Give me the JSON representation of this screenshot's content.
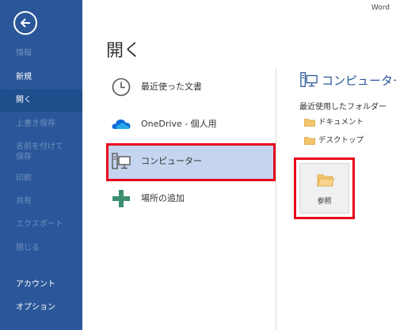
{
  "app": {
    "name": "Word"
  },
  "sidebar": {
    "items": [
      {
        "label": "情報"
      },
      {
        "label": "新規"
      },
      {
        "label": "開く"
      },
      {
        "label": "上書き保存"
      },
      {
        "label_line1": "名前を付けて",
        "label_line2": "保存"
      },
      {
        "label": "印刷"
      },
      {
        "label": "共有"
      },
      {
        "label": "エクスポート"
      },
      {
        "label": "閉じる"
      },
      {
        "label": "アカウント"
      },
      {
        "label": "オプション"
      }
    ]
  },
  "main": {
    "title": "開く",
    "places": [
      {
        "label": "最近使った文書",
        "icon": "clock-icon"
      },
      {
        "label": "OneDrive - 個人用",
        "icon": "onedrive-cloud-icon"
      },
      {
        "label": "コンピューター",
        "icon": "computer-icon",
        "selected": true
      },
      {
        "label": "場所の追加",
        "icon": "plus-icon"
      }
    ]
  },
  "right": {
    "title": "コンピューター",
    "recent_folders_label": "最近使用したフォルダー",
    "folders": [
      {
        "label": "ドキュメント"
      },
      {
        "label": "デスクトップ"
      }
    ],
    "browse_label": "参照"
  },
  "colors": {
    "sidebar_bg": "#2b579a",
    "selected_place_bg": "#c5d5ef",
    "highlight_border": "#e8001a",
    "folder": "#f2c46d"
  }
}
